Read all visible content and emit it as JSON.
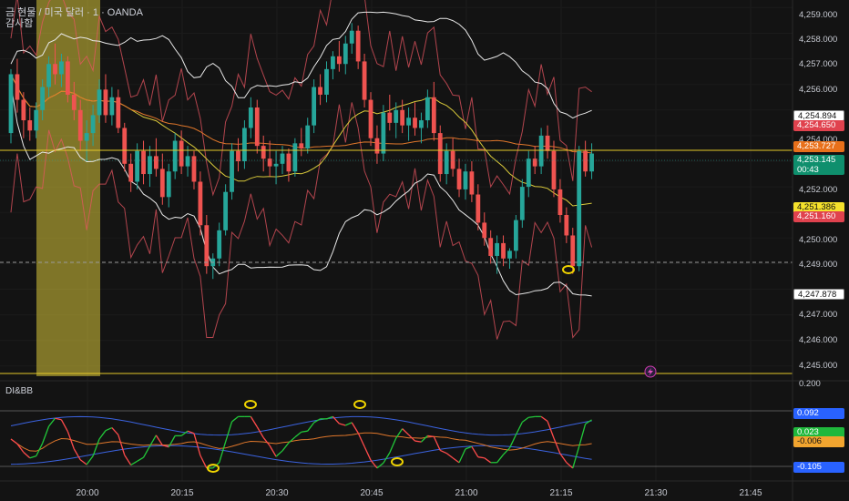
{
  "header": {
    "title": "금 현물 / 미국 달러 · 1 · OANDA",
    "subtitle": "감사함"
  },
  "indicator": {
    "label": "DI&BB"
  },
  "price_axis": {
    "ticks": [
      "4,259.000",
      "4,258.000",
      "4,257.000",
      "4,256.000",
      "4,254.000",
      "4,252.000",
      "4,250.000",
      "4,249.000",
      "4,247.000",
      "4,246.000",
      "4,245.000",
      "0.200"
    ]
  },
  "time_axis": {
    "ticks": [
      "20:00",
      "20:15",
      "20:30",
      "20:45",
      "21:00",
      "21:15",
      "21:30",
      "21:45"
    ]
  },
  "price_tags": {
    "upper_band": "4,254.894",
    "red_level": "4,254.650",
    "orange_level": "4,253.727",
    "last_price": "4,253.145",
    "countdown": "00:43",
    "mid_band": "4,251.386",
    "red_level2": "4,251.160",
    "lower_band": "4,247.878"
  },
  "indicator_tags": {
    "upper": "0.092",
    "green": "0.023",
    "orange": "-0.006",
    "lower": "-0.105"
  },
  "colors": {
    "bull": "#26a69a",
    "bear": "#ef5350",
    "band": "#e8e8e8",
    "ma": "#d9c93a",
    "orange_ma": "#e0772b",
    "envelope": "#e85562",
    "highlight": "#e6d32c",
    "di_green": "#22c83a",
    "di_red": "#ff4b4b",
    "bb_blue": "#3b63e0"
  },
  "chart_data": {
    "type": "candlestick",
    "symbol": "XAUUSD",
    "interval_minutes": 1,
    "ylim": [
      4244.6,
      4259.3
    ],
    "start_time": "19:52",
    "candles": [
      [
        4254.1,
        4256.6,
        4253.7,
        4256.4
      ],
      [
        4256.4,
        4257.0,
        4254.9,
        4255.4
      ],
      [
        4255.4,
        4255.7,
        4253.9,
        4254.6
      ],
      [
        4254.6,
        4255.1,
        4253.8,
        4254.2
      ],
      [
        4254.2,
        4255.3,
        4253.9,
        4255.0
      ],
      [
        4255.0,
        4256.2,
        4254.6,
        4255.9
      ],
      [
        4255.9,
        4257.1,
        4255.5,
        4256.8
      ],
      [
        4256.8,
        4257.6,
        4256.0,
        4256.4
      ],
      [
        4256.4,
        4257.2,
        4255.9,
        4256.9
      ],
      [
        4256.9,
        4257.1,
        4255.3,
        4255.6
      ],
      [
        4255.6,
        4256.1,
        4254.6,
        4255.0
      ],
      [
        4255.0,
        4255.4,
        4253.4,
        4253.8
      ],
      [
        4253.8,
        4254.6,
        4253.0,
        4254.1
      ],
      [
        4254.1,
        4255.2,
        4253.6,
        4254.8
      ],
      [
        4254.8,
        4256.2,
        4254.5,
        4255.8
      ],
      [
        4255.8,
        4256.4,
        4254.5,
        4254.8
      ],
      [
        4254.8,
        4255.9,
        4254.4,
        4255.5
      ],
      [
        4255.5,
        4255.8,
        4254.1,
        4254.3
      ],
      [
        4254.3,
        4254.5,
        4252.6,
        4252.9
      ],
      [
        4252.9,
        4253.3,
        4251.8,
        4252.2
      ],
      [
        4252.2,
        4253.7,
        4251.9,
        4253.4
      ],
      [
        4253.4,
        4253.8,
        4252.1,
        4252.5
      ],
      [
        4252.5,
        4253.6,
        4252.0,
        4253.2
      ],
      [
        4253.2,
        4253.9,
        4252.4,
        4252.7
      ],
      [
        4252.7,
        4253.3,
        4251.3,
        4251.6
      ],
      [
        4251.6,
        4252.9,
        4251.2,
        4252.6
      ],
      [
        4252.6,
        4254.1,
        4252.3,
        4253.8
      ],
      [
        4253.8,
        4254.2,
        4252.5,
        4252.8
      ],
      [
        4252.8,
        4253.6,
        4252.4,
        4253.2
      ],
      [
        4253.2,
        4253.4,
        4251.9,
        4252.2
      ],
      [
        4252.2,
        4252.6,
        4250.1,
        4250.5
      ],
      [
        4250.5,
        4250.9,
        4248.6,
        4248.9
      ],
      [
        4248.9,
        4249.4,
        4248.4,
        4249.2
      ],
      [
        4249.2,
        4250.6,
        4248.9,
        4250.3
      ],
      [
        4250.3,
        4252.1,
        4250.1,
        4251.8
      ],
      [
        4251.8,
        4253.7,
        4251.5,
        4253.4
      ],
      [
        4253.4,
        4253.9,
        4252.6,
        4253.0
      ],
      [
        4253.0,
        4254.6,
        4252.7,
        4254.3
      ],
      [
        4254.3,
        4255.5,
        4253.9,
        4255.1
      ],
      [
        4255.1,
        4255.4,
        4253.3,
        4253.6
      ],
      [
        4253.6,
        4254.0,
        4252.6,
        4253.1
      ],
      [
        4253.1,
        4253.8,
        4252.4,
        4252.8
      ],
      [
        4252.8,
        4253.4,
        4252.1,
        4252.9
      ],
      [
        4252.9,
        4253.6,
        4252.5,
        4253.3
      ],
      [
        4253.3,
        4253.5,
        4252.2,
        4252.6
      ],
      [
        4252.6,
        4253.9,
        4252.4,
        4253.7
      ],
      [
        4253.7,
        4254.3,
        4253.2,
        4253.5
      ],
      [
        4253.5,
        4254.7,
        4253.3,
        4254.4
      ],
      [
        4254.4,
        4256.2,
        4254.1,
        4255.9
      ],
      [
        4255.9,
        4256.4,
        4255.2,
        4255.6
      ],
      [
        4255.6,
        4256.9,
        4255.3,
        4256.6
      ],
      [
        4256.6,
        4257.3,
        4256.2,
        4257.1
      ],
      [
        4257.1,
        4257.7,
        4256.5,
        4256.8
      ],
      [
        4256.8,
        4257.9,
        4256.4,
        4257.6
      ],
      [
        4257.6,
        4258.4,
        4257.2,
        4258.1
      ],
      [
        4258.1,
        4258.3,
        4256.6,
        4256.9
      ],
      [
        4256.9,
        4257.2,
        4255.1,
        4255.4
      ],
      [
        4255.4,
        4255.7,
        4253.6,
        4253.9
      ],
      [
        4253.9,
        4254.4,
        4252.9,
        4253.3
      ],
      [
        4253.3,
        4255.2,
        4253.0,
        4254.9
      ],
      [
        4254.9,
        4255.6,
        4254.2,
        4254.5
      ],
      [
        4254.5,
        4255.3,
        4253.9,
        4255.0
      ],
      [
        4255.0,
        4255.4,
        4254.1,
        4254.4
      ],
      [
        4254.4,
        4255.1,
        4253.8,
        4254.7
      ],
      [
        4254.7,
        4255.3,
        4254.0,
        4254.3
      ],
      [
        4254.3,
        4254.9,
        4253.7,
        4254.6
      ],
      [
        4254.6,
        4255.8,
        4254.3,
        4255.5
      ],
      [
        4255.5,
        4256.1,
        4253.8,
        4254.1
      ],
      [
        4254.1,
        4254.4,
        4252.2,
        4252.5
      ],
      [
        4252.5,
        4253.7,
        4252.1,
        4253.4
      ],
      [
        4253.4,
        4253.9,
        4252.4,
        4252.7
      ],
      [
        4252.7,
        4253.1,
        4251.6,
        4251.9
      ],
      [
        4251.9,
        4252.9,
        4251.5,
        4252.6
      ],
      [
        4252.6,
        4253.0,
        4251.4,
        4251.7
      ],
      [
        4251.7,
        4252.1,
        4250.3,
        4250.6
      ],
      [
        4250.6,
        4251.0,
        4249.7,
        4250.0
      ],
      [
        4250.0,
        4250.3,
        4249.0,
        4249.3
      ],
      [
        4249.3,
        4250.1,
        4248.6,
        4249.8
      ],
      [
        4249.8,
        4250.1,
        4248.9,
        4249.2
      ],
      [
        4249.2,
        4249.6,
        4248.8,
        4249.5
      ],
      [
        4249.5,
        4250.9,
        4249.2,
        4250.7
      ],
      [
        4250.7,
        4252.3,
        4250.4,
        4252.0
      ],
      [
        4252.0,
        4253.4,
        4251.6,
        4253.1
      ],
      [
        4253.1,
        4253.6,
        4252.5,
        4252.8
      ],
      [
        4252.8,
        4254.3,
        4252.5,
        4254.0
      ],
      [
        4254.0,
        4254.4,
        4253.1,
        4253.4
      ],
      [
        4253.4,
        4253.8,
        4251.6,
        4251.9
      ],
      [
        4251.9,
        4252.3,
        4250.6,
        4250.9
      ],
      [
        4250.9,
        4251.2,
        4249.8,
        4250.1
      ],
      [
        4250.1,
        4250.4,
        4248.6,
        4248.9
      ],
      [
        4248.9,
        4253.6,
        4248.7,
        4253.4
      ],
      [
        4253.4,
        4253.8,
        4252.4,
        4252.6
      ],
      [
        4252.6,
        4253.7,
        4252.3,
        4253.3
      ]
    ],
    "annotations": [
      "20:00 – 20:04 highlighted zone",
      "dashed level 4,249.0",
      "horizontal level 4,244.9"
    ]
  }
}
